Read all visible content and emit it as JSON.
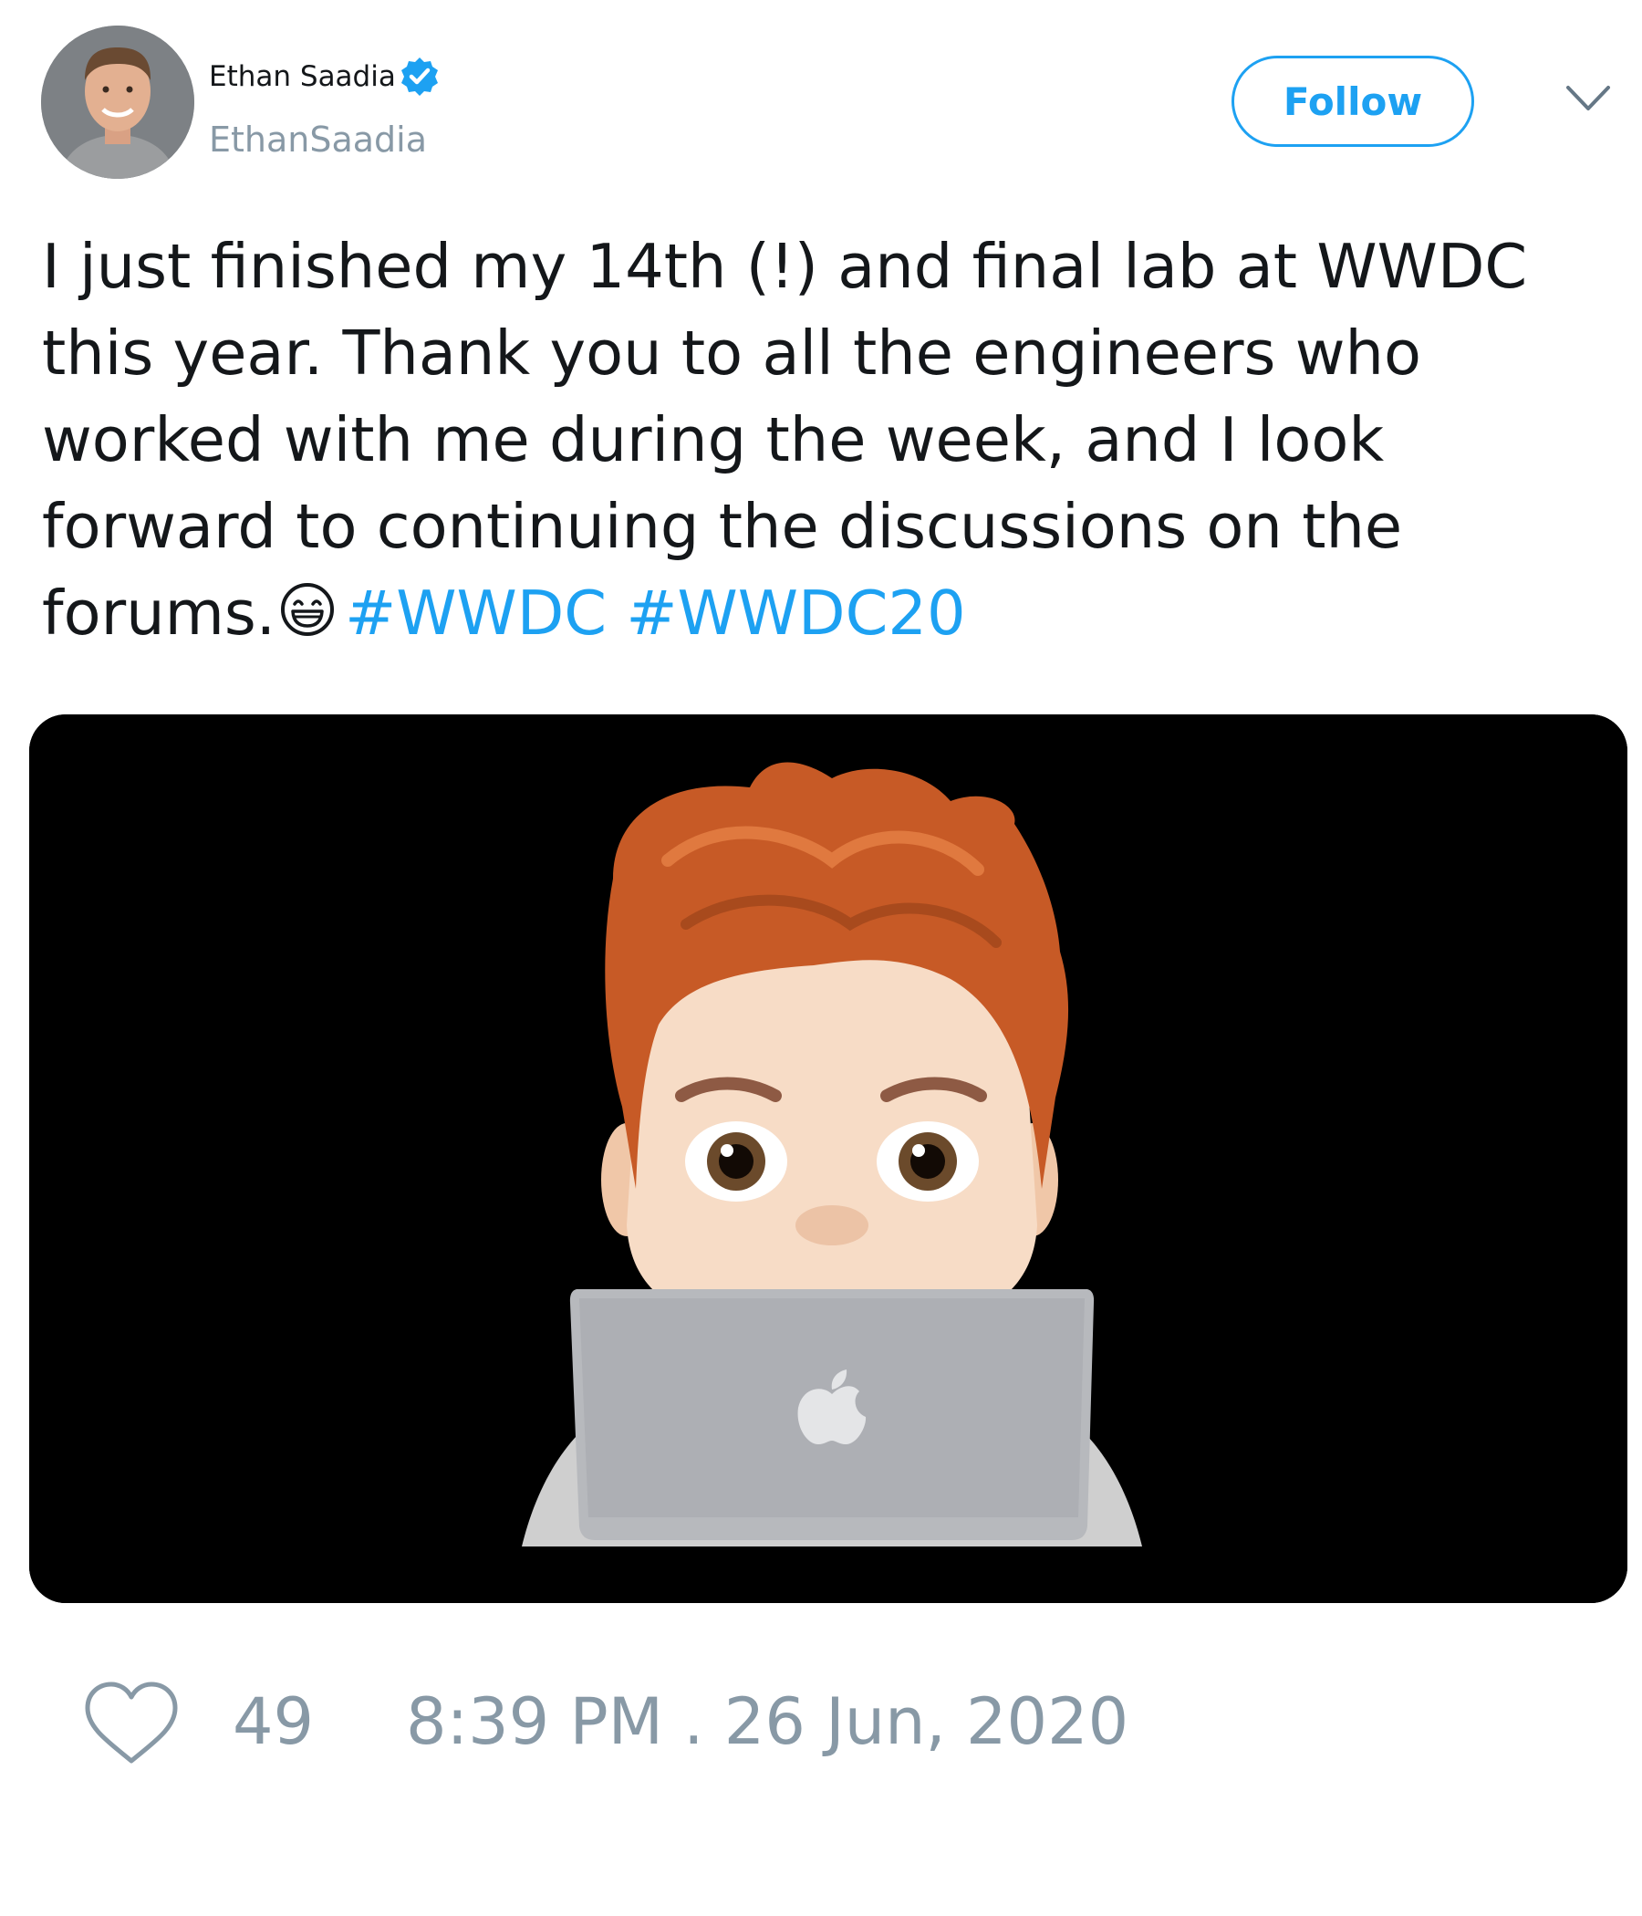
{
  "author": {
    "display_name": "Ethan Saadia",
    "handle": "EthanSaadia",
    "verified": true
  },
  "follow_label": "Follow",
  "tweet": {
    "lines": [
      "I just finished my 14th (!) and final lab at WWDC",
      "this year. Thank you to all the engineers who",
      "worked with me during the week, and I look",
      "forward to continuing the discussions on the",
      "forums."
    ],
    "emoji": "grinning-face-with-smiling-eyes",
    "hashtags": [
      "#WWDC",
      "#WWDC20"
    ]
  },
  "media": {
    "subject": "memoji-behind-laptop",
    "background_color": "#000000"
  },
  "footer": {
    "like_count": "49",
    "timestamp": "8:39 PM . 26 Jun, 2020"
  },
  "colors": {
    "accent": "#1da1f2",
    "muted": "#8899a6",
    "text": "#14171a"
  }
}
